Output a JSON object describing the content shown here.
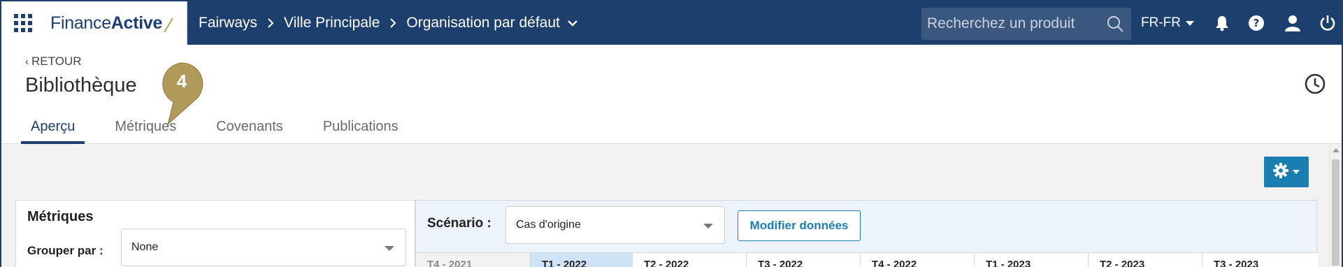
{
  "brand": {
    "name_regular": "Finance",
    "name_bold": "Active",
    "accent_color": "#1d3f6e",
    "button_color": "#1a7fb0"
  },
  "breadcrumb": {
    "items": [
      "Fairways",
      "Ville Principale",
      "Organisation par défaut"
    ]
  },
  "search": {
    "placeholder": "Recherchez un produit"
  },
  "language": {
    "current": "FR-FR"
  },
  "header": {
    "back_label": "RETOUR",
    "title": "Bibliothèque",
    "step_badge": "4",
    "tabs": [
      {
        "label": "Aperçu",
        "active": true
      },
      {
        "label": "Métriques",
        "active": false
      },
      {
        "label": "Covenants",
        "active": false
      },
      {
        "label": "Publications",
        "active": false
      }
    ]
  },
  "metrics_panel": {
    "title": "Métriques",
    "group_by_label": "Grouper par :",
    "group_by_value": "None"
  },
  "scenario_panel": {
    "scenario_label": "Scénario :",
    "scenario_value": "Cas d'origine",
    "modify_button": "Modifier données",
    "quarters": [
      "T4 - 2021",
      "T1 - 2022",
      "T2 - 2022",
      "T3 - 2022",
      "T4 - 2022",
      "T1 - 2023",
      "T2 - 2023",
      "T3 - 2023"
    ]
  },
  "icons": [
    "apps-grid-icon",
    "chevron-right-icon",
    "chevron-down-icon",
    "search-icon",
    "bell-icon",
    "help-icon",
    "user-icon",
    "power-icon",
    "history-icon",
    "gear-icon"
  ]
}
